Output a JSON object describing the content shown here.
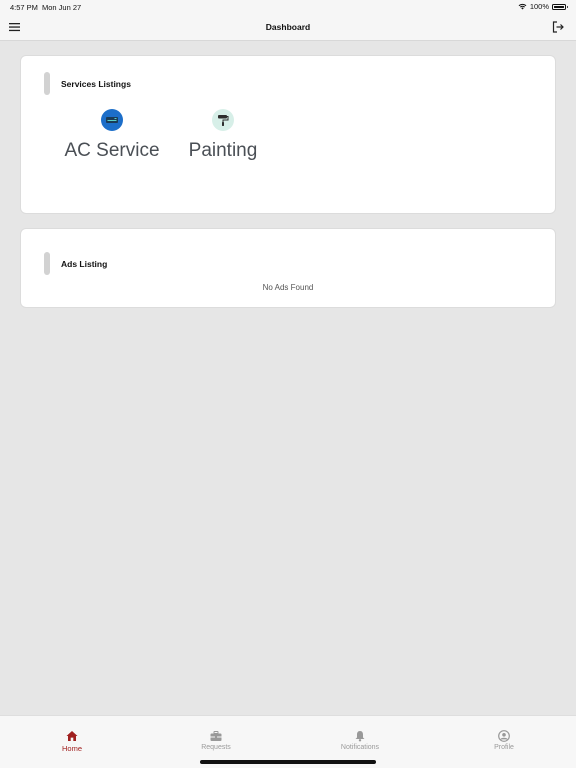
{
  "status_bar": {
    "time": "4:57 PM",
    "date": "Mon Jun 27",
    "battery_percent": "100%",
    "battery_level": 1.0
  },
  "nav": {
    "title": "Dashboard",
    "left_icon": "hamburger-menu-icon",
    "right_icon": "logout-icon"
  },
  "services_card": {
    "title": "Services Listings",
    "items": [
      {
        "label": "AC Service",
        "icon": "air-conditioner-icon",
        "icon_bg": "#1c6ec9"
      },
      {
        "label": "Painting",
        "icon": "paint-roller-icon",
        "icon_bg": "#d7efe8"
      }
    ]
  },
  "ads_card": {
    "title": "Ads Listing",
    "empty_message": "No Ads Found"
  },
  "tabs": [
    {
      "label": "Home",
      "icon": "home-icon",
      "active": true
    },
    {
      "label": "Requests",
      "icon": "toolbox-icon",
      "active": false
    },
    {
      "label": "Notifications",
      "icon": "bell-icon",
      "active": false
    },
    {
      "label": "Profile",
      "icon": "profile-icon",
      "active": false
    }
  ],
  "colors": {
    "accent": "#a0201f",
    "background": "#e6e6e6",
    "inactive_tab": "#9a9a9a"
  }
}
